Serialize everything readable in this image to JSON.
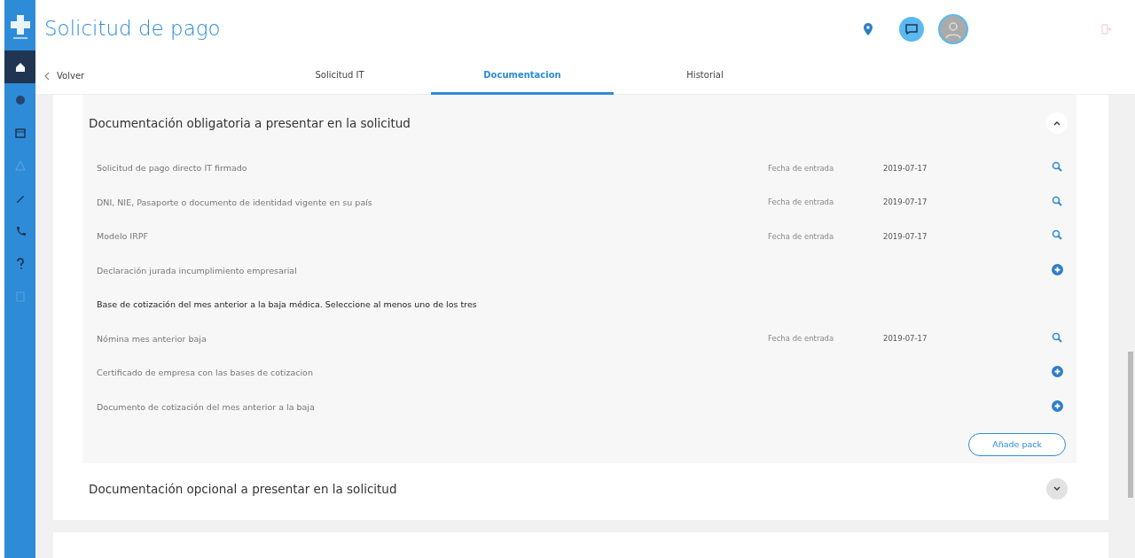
{
  "header": {
    "title": "Solicitud de pago"
  },
  "sidebar": {
    "items": [
      {
        "selected": true
      },
      {
        "selected": false
      },
      {
        "selected": false
      },
      {
        "selected": false
      },
      {
        "selected": false
      },
      {
        "selected": false
      },
      {
        "selected": false
      },
      {
        "selected": false
      }
    ]
  },
  "back_link": "Volver",
  "tabs": [
    {
      "label": "Solicitud IT",
      "selected": false
    },
    {
      "label": "Documentacion",
      "selected": true
    },
    {
      "label": "Historial",
      "selected": false
    }
  ],
  "sections": [
    {
      "title": "Documentación obligatoria a presentar en la solicitud",
      "expanded": true,
      "rows": [
        {
          "kind": "uploaded",
          "label": "Solicitud de pago directo IT firmado",
          "date_label": "Fecha de entrada",
          "date": "2019-07-17"
        },
        {
          "kind": "uploaded",
          "label": "DNI, NIE, Pasaporte o documento de identidad vigente en su país",
          "date_label": "Fecha de entrada",
          "date": "2019-07-17"
        },
        {
          "kind": "uploaded",
          "label": "Modelo IRPF",
          "date_label": "Fecha de entrada",
          "date": "2019-07-17"
        },
        {
          "kind": "pending",
          "label": "Declaración jurada incumplimiento empresarial"
        },
        {
          "kind": "group_heading",
          "label": "Base de cotización del mes anterior a la baja médica. Seleccione al menos uno de los tres"
        },
        {
          "kind": "uploaded",
          "label": "Nómina mes anterior baja",
          "date_label": "Fecha de entrada",
          "date": "2019-07-17"
        },
        {
          "kind": "pending",
          "label": "Certificado de empresa con las bases de cotizacion"
        },
        {
          "kind": "pending",
          "label": "Documento de cotización del mes anterior a la baja"
        }
      ],
      "button": "Añade pack"
    },
    {
      "title": "Documentación opcional a presentar en la solicitud",
      "expanded": false
    }
  ]
}
